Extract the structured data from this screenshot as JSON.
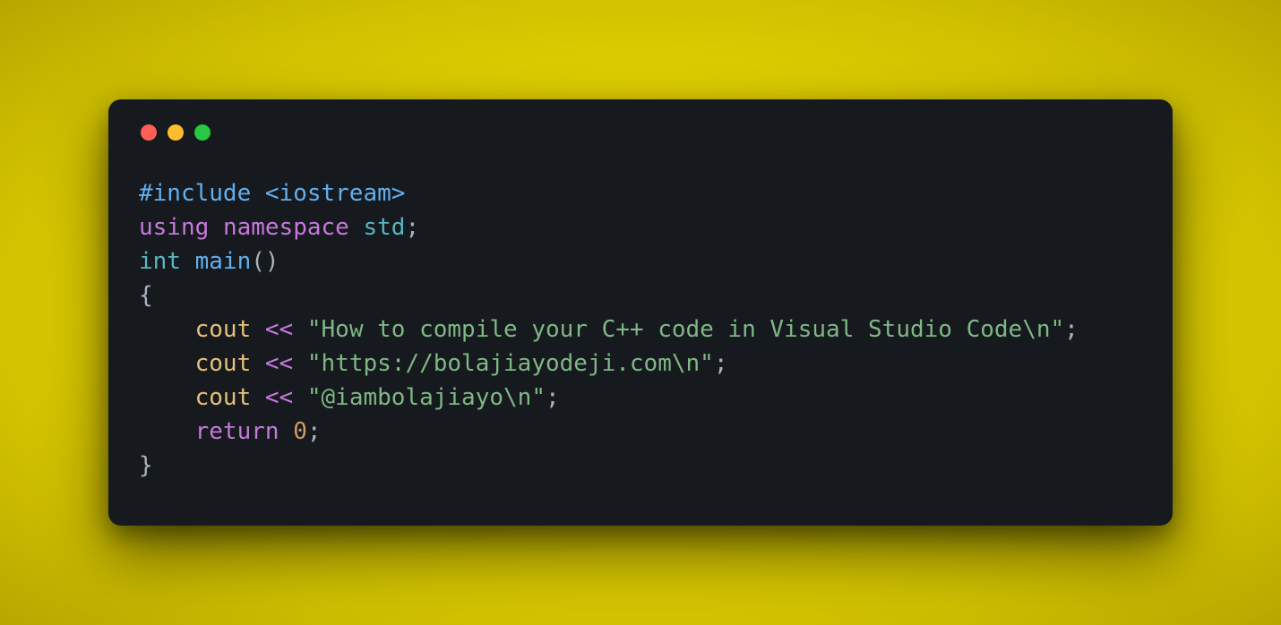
{
  "window": {
    "traffic_lights": {
      "red": "#ff5f57",
      "yellow": "#febc2e",
      "green": "#28c840"
    },
    "bg": "#16191d"
  },
  "code": {
    "l1_include": "#include ",
    "l1_header": "<iostream>",
    "l2_using": "using",
    "l2_namespace": "namespace",
    "l2_std": "std",
    "l2_semi": ";",
    "l3_int": "int",
    "l3_main": "main",
    "l3_parens": "()",
    "l4_open": "{",
    "l5_indent": "    ",
    "l5_cout": "cout",
    "l5_op": "<<",
    "l5_str": "\"How to compile your C++ code in Visual Studio Code\\n\"",
    "l5_semi": ";",
    "l6_indent": "    ",
    "l6_cout": "cout",
    "l6_op": "<<",
    "l6_str": "\"https://bolajiayodeji.com\\n\"",
    "l6_semi": ";",
    "l7_indent": "    ",
    "l7_cout": "cout",
    "l7_op": "<<",
    "l7_str": "\"@iambolajiayo\\n\"",
    "l7_semi": ";",
    "l8_indent": "    ",
    "l8_return": "return",
    "l8_zero": "0",
    "l8_semi": ";",
    "l9_close": "}"
  }
}
